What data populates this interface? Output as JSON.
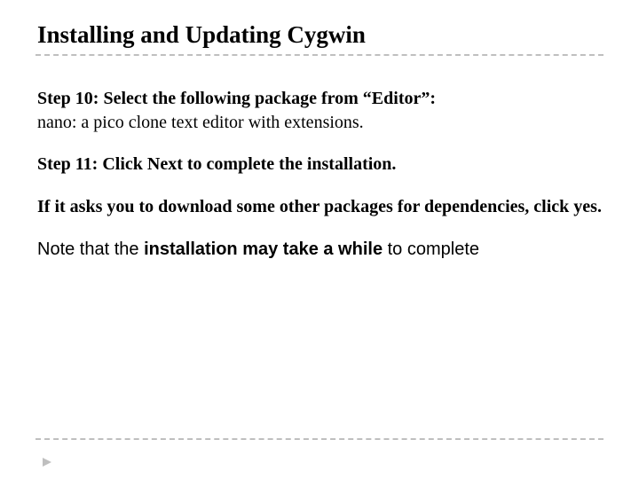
{
  "title": "Installing and Updating Cygwin",
  "step10": {
    "bold_prefix": "Step 10: Select the following package from “Editor”:",
    "desc": "nano: a pico clone text editor with extensions."
  },
  "step11": "Step 11: Click Next to complete the installation.",
  "deps": "If it asks you to download some other packages for dependencies, click yes.",
  "note": {
    "pre": "Note that the ",
    "bold": "installation may take a while",
    "post": " to complete"
  }
}
